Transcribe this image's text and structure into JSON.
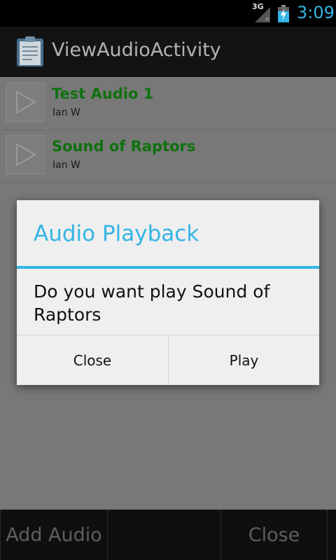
{
  "status_bar": {
    "network_label": "3G",
    "time": "3:09"
  },
  "action_bar": {
    "title": "ViewAudioActivity",
    "icon": "clipboard-icon"
  },
  "list": {
    "items": [
      {
        "title": "Test Audio 1",
        "author": "Ian W"
      },
      {
        "title": "Sound of Raptors",
        "author": "Ian W"
      }
    ]
  },
  "bottom_bar": {
    "left_label": "Add Audio",
    "right_label": "Close"
  },
  "dialog": {
    "title": "Audio Playback",
    "message": "Do you want play Sound of Raptors",
    "negative_label": "Close",
    "positive_label": "Play"
  },
  "colors": {
    "accent": "#33b5e5",
    "item_title": "#0f710f"
  }
}
